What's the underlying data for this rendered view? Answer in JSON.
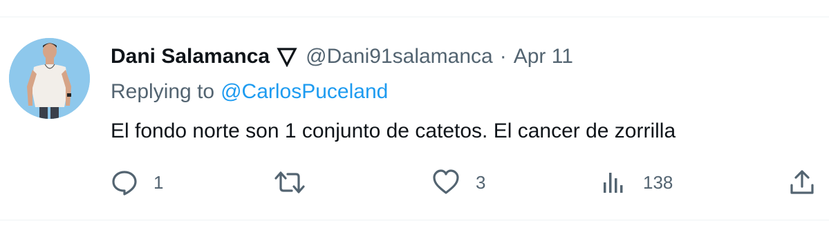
{
  "tweet": {
    "display_name": "Dani Salamanca",
    "badge_icon": "triangle-down-icon",
    "handle": "@Dani91salamanca",
    "separator": "·",
    "date": "Apr 11",
    "replying_prefix": "Replying to",
    "replying_to": "@CarlosPuceland",
    "text": "El fondo norte son 1 conjunto de catetos. El cancer de zorrilla",
    "avatar_icon": "user-avatar"
  },
  "actions": {
    "reply": {
      "icon": "reply-icon",
      "count": "1"
    },
    "retweet": {
      "icon": "retweet-icon",
      "count": ""
    },
    "like": {
      "icon": "heart-icon",
      "count": "3"
    },
    "views": {
      "icon": "analytics-icon",
      "count": "138"
    },
    "share": {
      "icon": "share-icon",
      "count": ""
    }
  },
  "colors": {
    "text_primary": "#0f1419",
    "text_secondary": "#536471",
    "link": "#1d9bf0",
    "divider": "#eff3f4",
    "avatar_bg": "#8ec8ec"
  }
}
